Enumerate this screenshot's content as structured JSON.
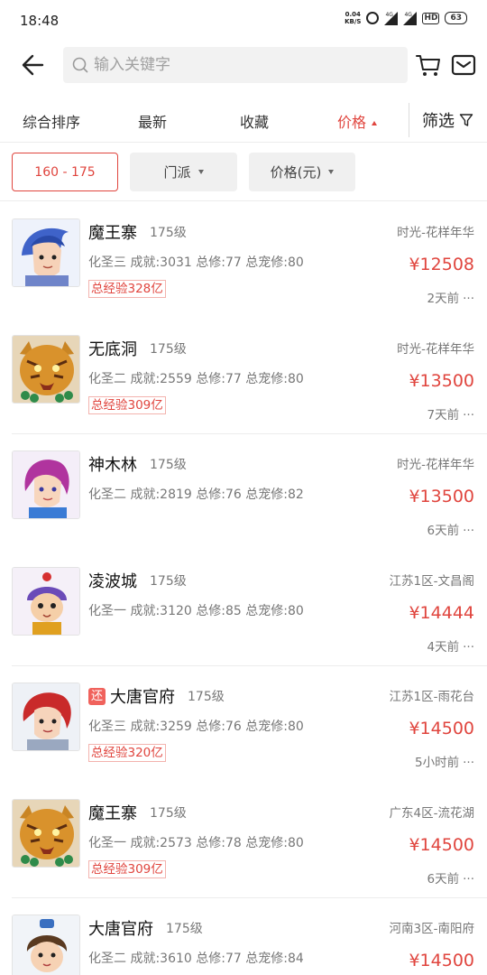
{
  "status_bar": {
    "time": "18:48",
    "net_speed_value": "0.04",
    "net_speed_unit": "KB/S",
    "sig1": "4G",
    "sig2": "4G",
    "hd": "HD",
    "battery": "63"
  },
  "header": {
    "search_placeholder": "输入关键字"
  },
  "sort_tabs": {
    "composite": "综合排序",
    "newest": "最新",
    "favorite": "收藏",
    "price": "价格",
    "filter": "筛选"
  },
  "filter_chips": {
    "level_range": "160 - 175",
    "school": "门派",
    "price_unit": "价格(元)"
  },
  "colors": {
    "accent": "#e0453e",
    "muted_text": "#777777",
    "chip_bg": "#f0f0f0"
  },
  "items": [
    {
      "name": "魔王寨",
      "level": "175级",
      "stats": "化圣三 成就:3031 总修:77 总宠修:80",
      "exp": "总经验328亿",
      "server": "时光-花样年华",
      "price": "¥12508",
      "time": "2天前",
      "avatar": "blue-warrior"
    },
    {
      "name": "无底洞",
      "level": "175级",
      "stats": "化圣二 成就:2559 总修:77 总宠修:80",
      "exp": "总经验309亿",
      "server": "时光-花样年华",
      "price": "¥13500",
      "time": "7天前",
      "avatar": "tiger-mask"
    },
    {
      "name": "神木林",
      "level": "175级",
      "stats": "化圣二 成就:2819 总修:76 总宠修:82",
      "exp": "",
      "server": "时光-花样年华",
      "price": "¥13500",
      "time": "6天前",
      "avatar": "purple-girl"
    },
    {
      "name": "凌波城",
      "level": "175级",
      "stats": "化圣一 成就:3120 总修:85 总宠修:80",
      "exp": "",
      "server": "江苏1区-文昌阁",
      "price": "¥14444",
      "time": "4天前",
      "avatar": "monkey-kid"
    },
    {
      "name": "大唐官府",
      "level": "175级",
      "stats": "化圣三 成就:3259 总修:76 总宠修:80",
      "exp": "总经验320亿",
      "server": "江苏1区-雨花台",
      "price": "¥14500",
      "time": "5小时前",
      "avatar": "red-hair",
      "badge": "还"
    },
    {
      "name": "魔王寨",
      "level": "175级",
      "stats": "化圣一 成就:2573 总修:78 总宠修:80",
      "exp": "总经验309亿",
      "server": "广东4区-流花湖",
      "price": "¥14500",
      "time": "6天前",
      "avatar": "tiger-mask"
    },
    {
      "name": "大唐官府",
      "level": "175级",
      "stats": "化圣二 成就:3610 总修:77 总宠修:84",
      "exp": "",
      "server": "河南3区-南阳府",
      "price": "¥14500",
      "time": "",
      "avatar": "brown-hero"
    }
  ]
}
